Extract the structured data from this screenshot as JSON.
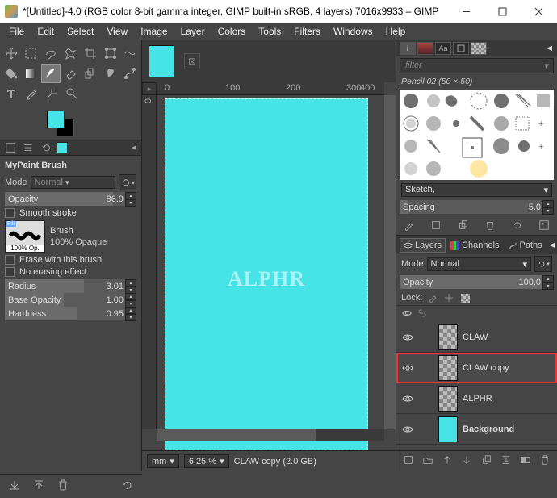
{
  "title": "*[Untitled]-4.0 (RGB color 8-bit gamma integer, GIMP built-in sRGB, 4 layers) 7016x9933 – GIMP",
  "menu": [
    "File",
    "Edit",
    "Select",
    "View",
    "Image",
    "Layer",
    "Colors",
    "Tools",
    "Filters",
    "Windows",
    "Help"
  ],
  "toolopt": {
    "title": "MyPaint Brush",
    "mode_label": "Mode",
    "mode_value": "Normal",
    "opacity_label": "Opacity",
    "opacity_value": "86.9",
    "smooth": "Smooth stroke",
    "brush_label": "Brush",
    "brush_fill": "Fill",
    "brush_op": "100% Op.",
    "brush_name": "100% Opaque",
    "erase": "Erase with this brush",
    "noerase": "No erasing effect",
    "radius_label": "Radius",
    "radius_value": "3.01",
    "baseop_label": "Base Opacity",
    "baseop_value": "1.00",
    "hardness_label": "Hardness",
    "hardness_value": "0.95"
  },
  "ruler": {
    "h": [
      "0",
      "100",
      "200",
      "300",
      "400"
    ],
    "v": [
      "0"
    ]
  },
  "watermark": "ALPHR",
  "status": {
    "unit": "mm",
    "zoom": "6.25 %",
    "info": "CLAW copy (2.0 GB)"
  },
  "brushes": {
    "tabs": [
      "i",
      "",
      "Aa",
      "",
      ""
    ],
    "filter": "filter",
    "name": "Pencil 02 (50 × 50)",
    "preset": "Sketch,",
    "spacing_label": "Spacing",
    "spacing_value": "5.0"
  },
  "layers": {
    "tabs": [
      "Layers",
      "Channels",
      "Paths"
    ],
    "mode_label": "Mode",
    "mode_value": "Normal",
    "opacity_label": "Opacity",
    "opacity_value": "100.0",
    "lock_label": "Lock:",
    "items": [
      {
        "name": "CLAW",
        "thumb": "check",
        "vis": true,
        "sel": false,
        "bold": false
      },
      {
        "name": "CLAW copy",
        "thumb": "check",
        "vis": true,
        "sel": true,
        "bold": false
      },
      {
        "name": "ALPHR",
        "thumb": "check",
        "vis": true,
        "sel": false,
        "bold": false
      },
      {
        "name": "Background",
        "thumb": "cyan",
        "vis": true,
        "sel": false,
        "bold": true
      }
    ]
  }
}
